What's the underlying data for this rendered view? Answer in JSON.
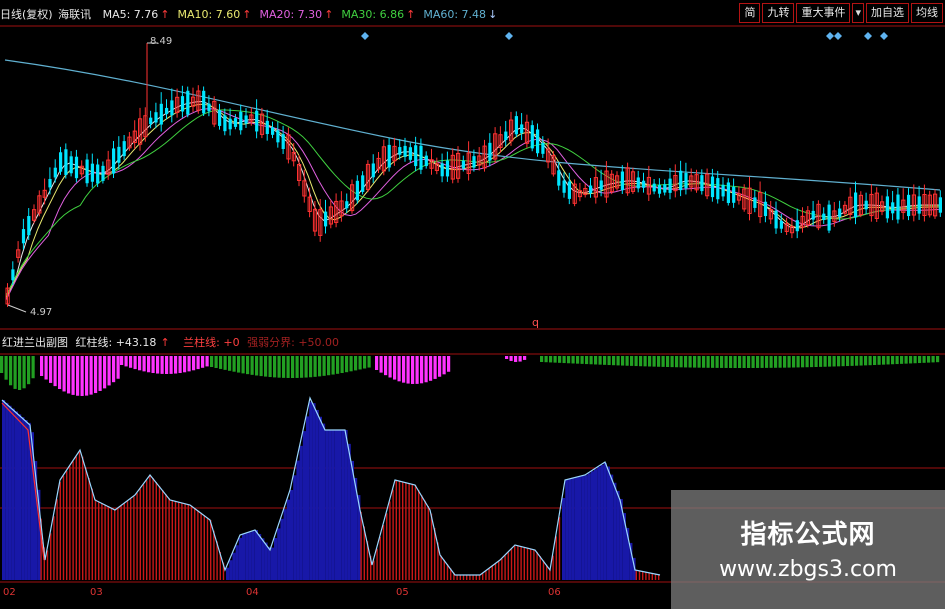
{
  "header": {
    "chart_name": "日线(复权)",
    "stock_name": "海联讯",
    "ma": [
      {
        "label": "MA5:",
        "value": "7.76",
        "color": "#e8e8e8",
        "dir": "up"
      },
      {
        "label": "MA10:",
        "value": "7.60",
        "color": "#e8e870",
        "dir": "up"
      },
      {
        "label": "MA20:",
        "value": "7.30",
        "color": "#e060e0",
        "dir": "up"
      },
      {
        "label": "MA30:",
        "value": "6.86",
        "color": "#40d040",
        "dir": "up"
      },
      {
        "label": "MA60:",
        "value": "7.48",
        "color": "#60b0d0",
        "dir": "down"
      }
    ]
  },
  "toolbar": [
    "简",
    "九转",
    "重大事件",
    "▾",
    "加自选",
    "均线"
  ],
  "price_labels": {
    "high": "8.49",
    "low": "4.97"
  },
  "marker_q": "q",
  "sub_header": {
    "title": "红进兰出副图",
    "red_label": "红柱线:",
    "red_value": "+43.18",
    "blue_label": "兰柱线:",
    "blue_value": "+0",
    "weak_label": "强弱分界:",
    "weak_value": "+50.00"
  },
  "x_axis": [
    "02",
    "03",
    "04",
    "05",
    "06"
  ],
  "watermark": {
    "title": "指标公式网",
    "url": "www.zbgs3.com"
  },
  "colors": {
    "up": "#ff3232",
    "down": "#00e5ff",
    "bg": "#000000",
    "grid": "#a01010",
    "blue_bar": "#1818a8",
    "red_bar": "#c81818",
    "magenta": "#ff33ff",
    "green": "#22a022"
  }
}
